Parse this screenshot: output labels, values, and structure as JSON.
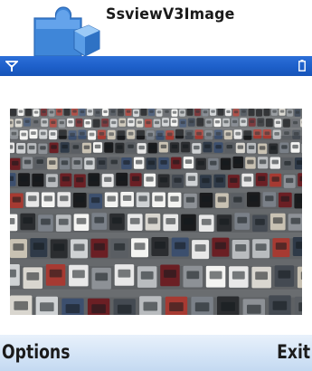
{
  "app": {
    "title": "SsviewV3Image",
    "icon": "puzzle-piece-icon"
  },
  "status_bar": {
    "signal_icon": "signal-antenna-icon",
    "battery_icon": "battery-icon",
    "accent_color": "#1d5fc9"
  },
  "content": {
    "image_subject": "parking-lot-photo"
  },
  "softkeys": {
    "left_label": "Options",
    "right_label": "Exit"
  }
}
